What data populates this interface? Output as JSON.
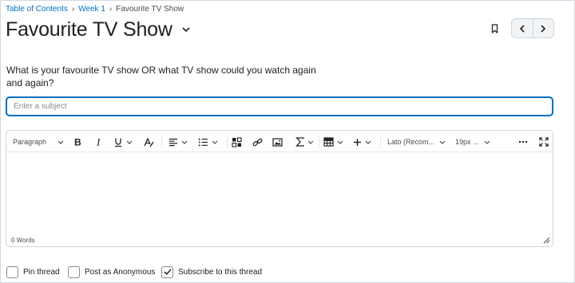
{
  "breadcrumb": {
    "items": [
      "Table of Contents",
      "Week 1"
    ],
    "separator": "›",
    "current": "Favourite TV Show"
  },
  "title": "Favourite TV Show",
  "question": "What is your favourite TV show OR what TV show could you watch again and again?",
  "subject": {
    "value": "",
    "placeholder": "Enter a subject"
  },
  "toolbar": {
    "format": "Paragraph",
    "font": "Lato (Recom...",
    "size": "19px ..."
  },
  "word_count": "0 Words",
  "options": {
    "pin": {
      "label": "Pin thread",
      "checked": false
    },
    "anonymous": {
      "label": "Post as Anonymous",
      "checked": false
    },
    "subscribe": {
      "label": "Subscribe to this thread",
      "checked": true
    }
  },
  "colors": {
    "link": "#006fbf",
    "focus": "#006fbf",
    "text": "#202122",
    "border": "#cdd5dc"
  }
}
